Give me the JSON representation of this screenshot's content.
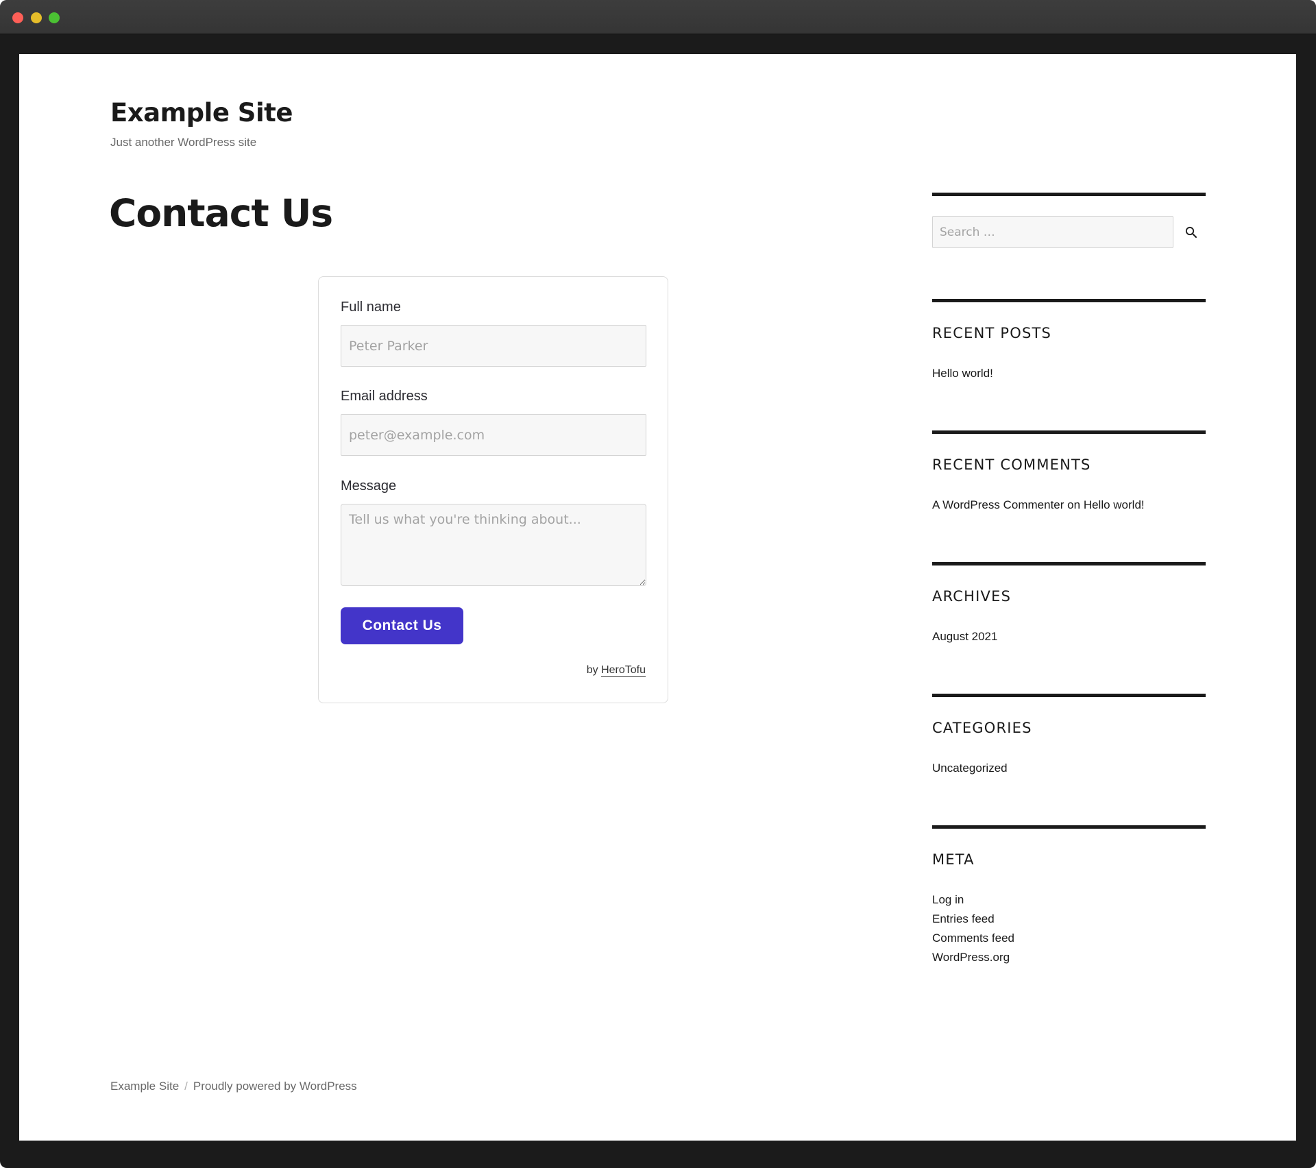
{
  "window": {
    "controls": [
      "close",
      "minimize",
      "zoom"
    ]
  },
  "site": {
    "title": "Example Site",
    "description": "Just another WordPress site"
  },
  "page": {
    "title": "Contact Us"
  },
  "form": {
    "name_label": "Full name",
    "name_placeholder": "Peter Parker",
    "name_value": "",
    "email_label": "Email address",
    "email_placeholder": "peter@example.com",
    "email_value": "",
    "message_label": "Message",
    "message_placeholder": "Tell us what you're thinking about...",
    "message_value": "",
    "submit_label": "Contact Us",
    "submit_color": "#4335c9",
    "credit_prefix": "by",
    "credit_link": "HeroTofu"
  },
  "sidebar": {
    "search": {
      "placeholder": "Search …",
      "value": "",
      "icon": "search-icon"
    },
    "widgets": [
      {
        "title": "Recent Posts",
        "items": [
          "Hello world!"
        ]
      },
      {
        "title": "Recent Comments",
        "items": [
          {
            "author": "A WordPress Commenter",
            "connector": "on",
            "post": "Hello world!"
          }
        ]
      },
      {
        "title": "Archives",
        "items": [
          "August 2021"
        ]
      },
      {
        "title": "Categories",
        "items": [
          "Uncategorized"
        ]
      },
      {
        "title": "Meta",
        "items": [
          "Log in",
          "Entries feed",
          "Comments feed",
          "WordPress.org"
        ]
      }
    ]
  },
  "footer": {
    "site_link": "Example Site",
    "separator": "/",
    "powered_by": "Proudly powered by WordPress"
  }
}
